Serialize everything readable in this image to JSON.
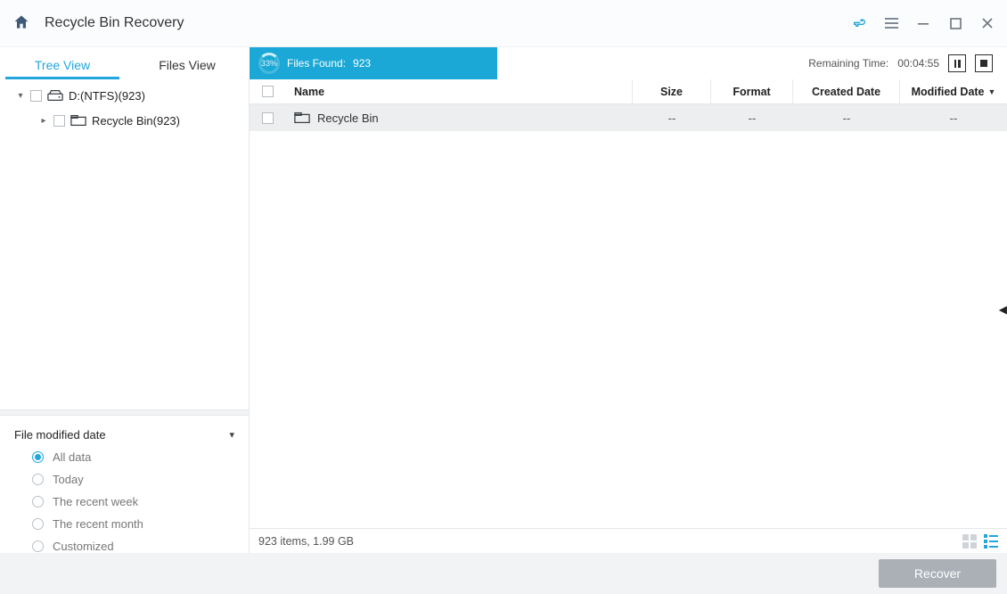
{
  "window": {
    "title": "Recycle Bin Recovery"
  },
  "tabs": {
    "tree": "Tree View",
    "files": "Files View"
  },
  "progress": {
    "percent": "33%",
    "label": "Files Found:",
    "count": "923"
  },
  "status": {
    "remaining_label": "Remaining Time:",
    "remaining_value": "00:04:55"
  },
  "tree": {
    "root": {
      "label": "D:(NTFS)(923)"
    },
    "child": {
      "label": "Recycle Bin(923)"
    }
  },
  "columns": {
    "name": "Name",
    "size": "Size",
    "format": "Format",
    "created": "Created Date",
    "modified": "Modified Date"
  },
  "rows": [
    {
      "name": "Recycle Bin",
      "size": "--",
      "format": "--",
      "created": "--",
      "modified": "--"
    }
  ],
  "filter": {
    "title": "File modified date",
    "options": {
      "all": "All data",
      "today": "Today",
      "week": "The recent week",
      "month": "The recent month",
      "custom": "Customized"
    }
  },
  "statusbar": {
    "summary": "923 items, 1.99 GB"
  },
  "footer": {
    "recover": "Recover"
  }
}
